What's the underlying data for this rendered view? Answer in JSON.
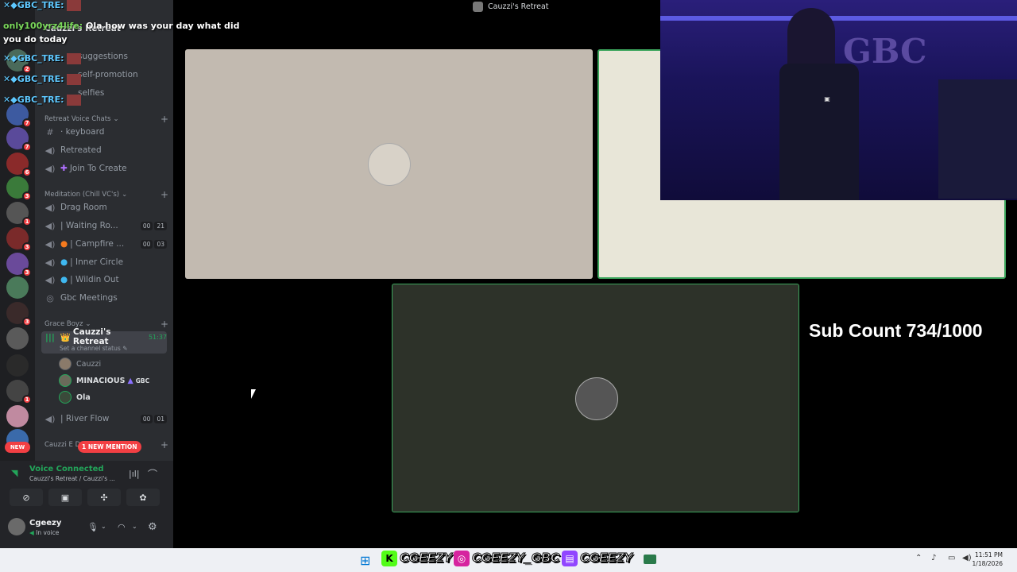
{
  "chat_overlay": {
    "tag": "GBC_TRE:",
    "message_user": "only100yrz4life:",
    "message_text": "Ola how was your day what did you do today"
  },
  "server_rail": {
    "badges": [
      "2",
      "7",
      "7",
      "6",
      "3",
      "1",
      "3",
      "3",
      "3",
      "1",
      "1"
    ],
    "new_label": "NEW"
  },
  "sidebar": {
    "server_name": "Cauzzi's Retreat",
    "top_channels": [
      "suggestions",
      "self-promotion",
      "selfies"
    ],
    "categories": {
      "voice_chats": "Retreat Voice Chats",
      "meditation": "Meditation (Chill VC's)",
      "grace_boyz": "Grace Boyz",
      "cauzzi_e": "Cauzzi E D..."
    },
    "voice_channels": [
      {
        "name": "· keyboard",
        "glyph": "#"
      },
      {
        "name": "Retreated",
        "glyph": "🔊"
      },
      {
        "name": "Join To Create",
        "glyph": "🔊"
      }
    ],
    "meditation_channels": [
      {
        "name": "Drag Room",
        "counts": []
      },
      {
        "name": "| Waiting Ro...",
        "counts": [
          "00",
          "21"
        ]
      },
      {
        "name": "| Campfire ...",
        "counts": [
          "00",
          "03"
        ]
      },
      {
        "name": "| Inner Circle",
        "counts": []
      },
      {
        "name": "| Wildin Out",
        "counts": []
      },
      {
        "name": "Gbc Meetings",
        "counts": []
      }
    ],
    "active_channel": {
      "name": "Cauzzi's Retreat",
      "timer": "51:37",
      "status": "Set a channel status"
    },
    "members": [
      {
        "name": "Cauzzi",
        "tag": ""
      },
      {
        "name": "MINACIOUS",
        "tag": "GBC"
      },
      {
        "name": "Ola",
        "tag": ""
      }
    ],
    "river_flow": {
      "name": "| River Flow",
      "counts": [
        "00",
        "01"
      ]
    },
    "mention_label": "1 NEW MENTION"
  },
  "voice_panel": {
    "title": "Voice Connected",
    "subtitle": "Cauzzi's Retreat / Cauzzi's ...",
    "user": "Cgeezy",
    "user_status": "In voice"
  },
  "call": {
    "window_title": "Cauzzi's Retreat",
    "sub_count": "Sub Count 734/1000"
  },
  "taskbar": {
    "labels": [
      "CGEEZY",
      "CGEEZY_GBC",
      "CGEEZY"
    ],
    "time": "11:51 PM",
    "date": "1/18/2026"
  },
  "colors": {
    "tile_left": "#c2bab0",
    "tile_right": "#e8e6d8",
    "tile_bottom": "#2d3229",
    "green_border": "#3ba55c",
    "discord_red": "#f23f43"
  }
}
